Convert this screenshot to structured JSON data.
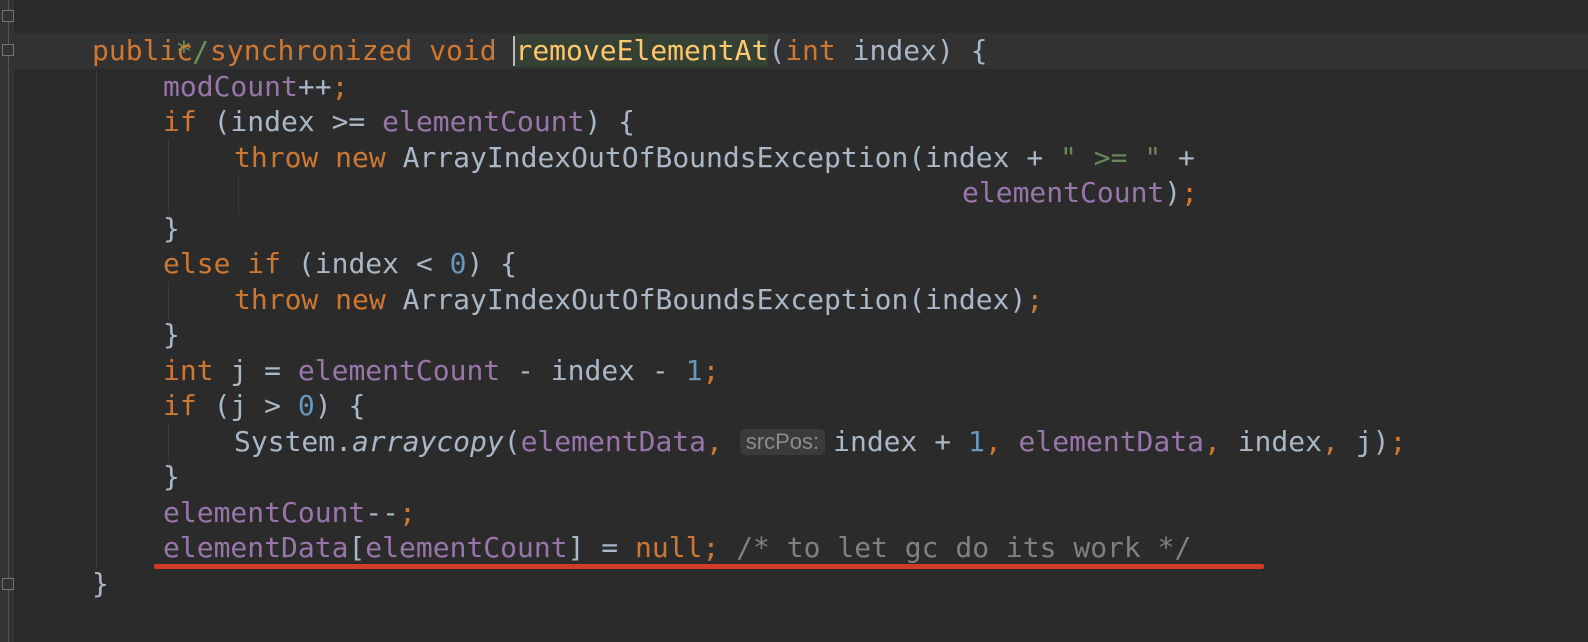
{
  "editor": {
    "code_lines": {
      "l0": {
        "doc_end": "*/"
      },
      "l1": {
        "kw1": "public",
        "kw2": "synchronized",
        "kw3": "void",
        "method": "removeElementAt",
        "paren_open": "(",
        "kw_int": "int",
        "param": "index",
        "paren_close": ") {"
      },
      "l2": {
        "field": "modCount",
        "op": "++",
        "semi": ";"
      },
      "l3": {
        "kw_if": "if",
        "open": " (index >= ",
        "field": "elementCount",
        "close": ") {"
      },
      "l4": {
        "kw_throw": "throw",
        "kw_new": "new",
        "cls": "ArrayIndexOutOfBoundsException(index + ",
        "str": "\" >= \"",
        "plus": " +"
      },
      "l5": {
        "field": "elementCount",
        "close": ")",
        "semi": ";"
      },
      "l6": {
        "brace": "}"
      },
      "l7": {
        "kw_else": "else",
        "kw_if": "if",
        "cond": " (index < ",
        "num": "0",
        "close": ") {"
      },
      "l8": {
        "kw_throw": "throw",
        "kw_new": "new",
        "cls": "ArrayIndexOutOfBoundsException(index)",
        "semi": ";"
      },
      "l9": {
        "brace": "}"
      },
      "l10": {
        "kw_int": "int",
        "var": " j = ",
        "field": "elementCount",
        "rest": " - index - ",
        "num": "1",
        "semi": ";"
      },
      "l11": {
        "kw_if": "if",
        "cond": " (j > ",
        "num": "0",
        "close": ") {"
      },
      "l12": {
        "cls": "System.",
        "method": "arraycopy",
        "open": "(",
        "field1": "elementData",
        "comma1": ",",
        "hint": "srcPos:",
        "expr": "index + ",
        "num": "1",
        "comma2": ",",
        "field2": "elementData",
        "comma3": ",",
        "arg": " index",
        "comma4": ",",
        "arg2": " j)",
        "semi": ";"
      },
      "l13": {
        "brace": "}"
      },
      "l14": {
        "field": "elementCount",
        "op": "--",
        "semi": ";"
      },
      "l15": {
        "field1": "elementData",
        "bracket_open": "[",
        "field2": "elementCount",
        "rest": "] = ",
        "kw_null": "null",
        "semi": ";",
        "comment": "/* to let gc do its work */"
      },
      "l16": {
        "brace": "}"
      }
    }
  },
  "colors": {
    "background": "#2b2b2b",
    "keyword": "#cc7832",
    "field": "#9876aa",
    "number": "#6897bb",
    "string": "#6a8759",
    "comment": "#808080",
    "method_declaration": "#ffc66d",
    "annotation_underline": "#d03c28"
  }
}
